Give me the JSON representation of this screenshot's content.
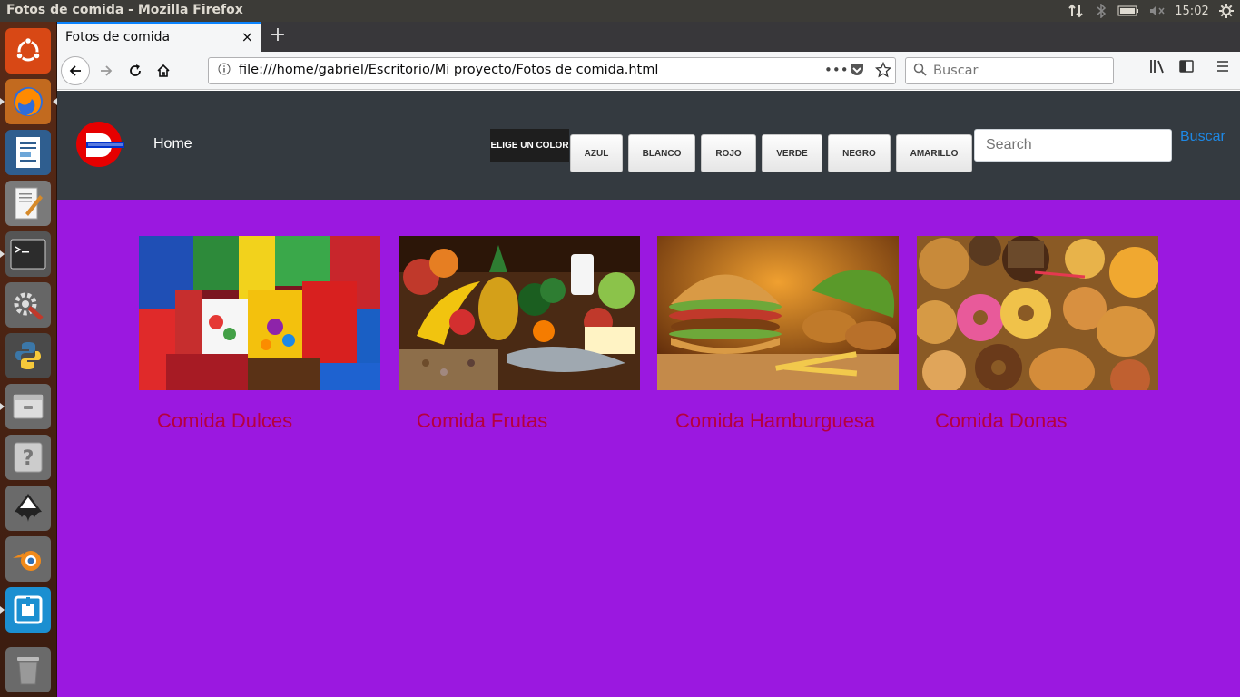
{
  "system": {
    "window_title": "Fotos de comida - Mozilla Firefox",
    "clock": "15:02"
  },
  "launcher": {
    "items": [
      "ubuntu-dash",
      "firefox",
      "libreoffice-writer",
      "text-editor",
      "terminal",
      "system-settings",
      "python",
      "files",
      "help",
      "inkscape",
      "blender",
      "app",
      "trash"
    ]
  },
  "browser": {
    "tab_title": "Fotos de comida",
    "tab_close": "×",
    "new_tab": "+",
    "url": "file:///home/gabriel/Escritorio/Mi proyecto/Fotos de comida.html",
    "search_placeholder": "Buscar",
    "url_actions": "•••"
  },
  "page": {
    "nav": {
      "home": "Home",
      "color_label": "ELIGE UN COLOR",
      "color_buttons": [
        "AZUL",
        "BLANCO",
        "ROJO",
        "VERDE",
        "NEGRO",
        "AMARILLO"
      ],
      "search_placeholder": "Search",
      "search_button": "Buscar"
    },
    "cards": [
      {
        "caption": "Comida Dulces"
      },
      {
        "caption": "Comida Frutas"
      },
      {
        "caption": "Comida Hamburguesa"
      },
      {
        "caption": "Comida Donas"
      }
    ],
    "colors": {
      "background": "#9b18e0",
      "navbar": "#343a40",
      "caption": "#b5003f",
      "link": "#1e88e5"
    }
  }
}
